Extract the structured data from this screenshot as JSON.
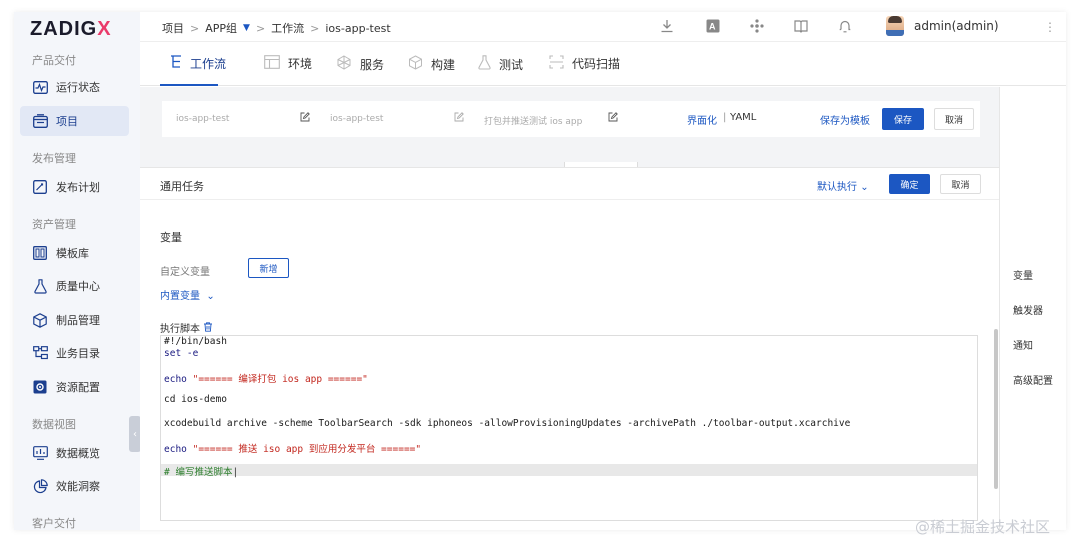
{
  "brand": {
    "logo_main": "ZADIG",
    "logo_x": "X"
  },
  "sidebar": {
    "sections": [
      "产品交付",
      "发布管理",
      "资产管理",
      "数据视图",
      "客户交付"
    ],
    "items": [
      {
        "label": "运行状态",
        "icon": "monitor-wave-icon"
      },
      {
        "label": "项目",
        "icon": "project-icon"
      },
      {
        "label": "发布计划",
        "icon": "release-plan-icon"
      },
      {
        "label": "模板库",
        "icon": "template-library-icon"
      },
      {
        "label": "质量中心",
        "icon": "flask-icon"
      },
      {
        "label": "制品管理",
        "icon": "package-icon"
      },
      {
        "label": "业务目录",
        "icon": "catalog-tree-icon"
      },
      {
        "label": "资源配置",
        "icon": "gear-icon"
      },
      {
        "label": "数据概览",
        "icon": "dashboard-chart-icon"
      },
      {
        "label": "效能洞察",
        "icon": "pie-chart-icon"
      }
    ],
    "collapse": "‹"
  },
  "breadcrumb": {
    "root": "项目",
    "group": "APP组",
    "section": "工作流",
    "current": "ios-app-test",
    "sep": ">"
  },
  "header": {
    "user": "admin(admin)",
    "more": "⋮"
  },
  "tabs": [
    {
      "label": "工作流",
      "icon": "workflow-icon"
    },
    {
      "label": "环境",
      "icon": "environment-icon"
    },
    {
      "label": "服务",
      "icon": "service-icon"
    },
    {
      "label": "构建",
      "icon": "build-icon"
    },
    {
      "label": "测试",
      "icon": "test-icon"
    },
    {
      "label": "代码扫描",
      "icon": "scan-icon"
    }
  ],
  "workflow_bar": {
    "name": "ios-app-test",
    "display_name": "ios-app-test",
    "description": "打包并推送测试 ios app",
    "mode_ui": "界面化",
    "mode_sep": "|",
    "mode_yaml": "YAML",
    "save_template": "保存为模板",
    "save": "保存",
    "cancel": "取消"
  },
  "job": {
    "title": "通用任务",
    "run_policy": "默认执行",
    "confirm": "确定",
    "cancel": "取消",
    "variables_title": "变量",
    "custom_vars_label": "自定义变量",
    "add_button": "新增",
    "builtin_vars": "内置变量",
    "script_label": "执行脚本"
  },
  "script": {
    "l1": "#!/bin/bash",
    "l2": "set -e",
    "l3_cmd": "echo ",
    "l3_str": "\"====== 编译打包 ios app ======\"",
    "l4": "cd ios-demo",
    "l5": "xcodebuild archive -scheme ToolbarSearch -sdk iphoneos -allowProvisioningUpdates -archivePath ./toolbar-output.xcarchive",
    "l6_cmd": "echo ",
    "l6_str": "\"====== 推送 iso app 到应用分发平台 ======\"",
    "l7": "# 编写推送脚本"
  },
  "right_nav": [
    "变量",
    "触发器",
    "通知",
    "高级配置"
  ],
  "watermark": "@稀土掘金技术社区",
  "colors": {
    "primary": "#1c57c2",
    "logo_x": "#ea3a6a",
    "string": "#c2261d",
    "comment": "#2b7d2b"
  }
}
